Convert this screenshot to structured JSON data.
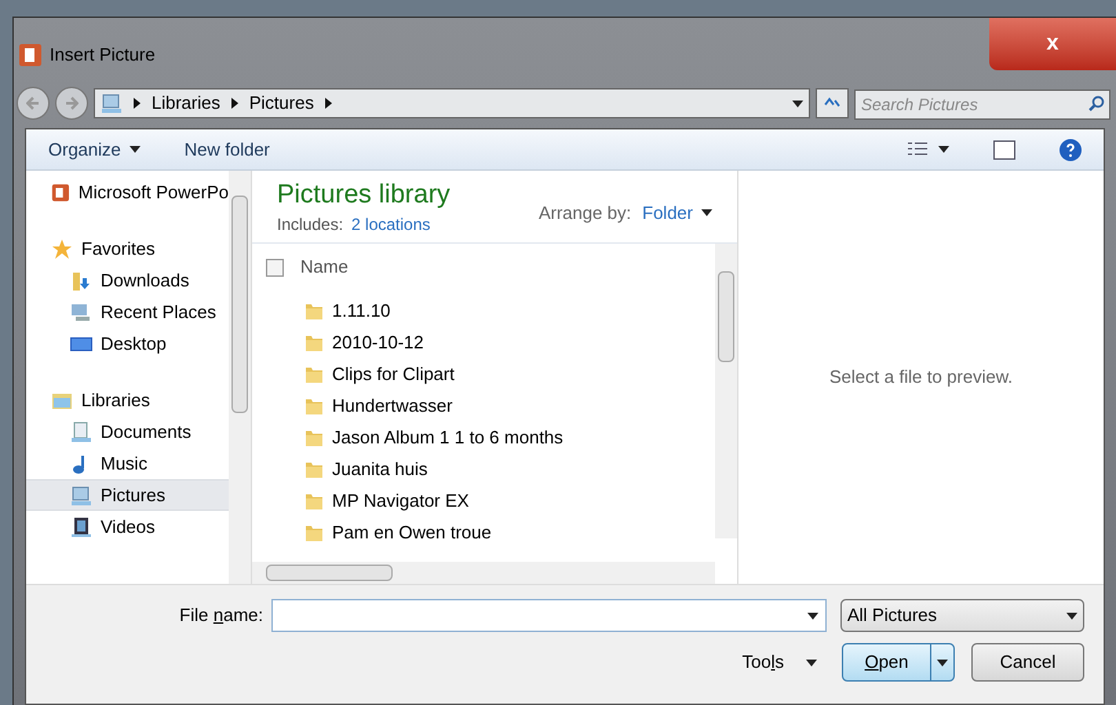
{
  "window": {
    "title": "Insert Picture",
    "close": "x"
  },
  "address": {
    "crumbs": [
      "Libraries",
      "Pictures"
    ],
    "search_placeholder": "Search Pictures"
  },
  "toolbar": {
    "organize": "Organize",
    "new_folder": "New folder"
  },
  "nav": [
    {
      "label": "Microsoft PowerPo",
      "kind": "app",
      "selected": false
    },
    {
      "label": "Favorites",
      "kind": "star",
      "selected": false,
      "children": [
        {
          "label": "Downloads",
          "kind": "download",
          "selected": false
        },
        {
          "label": "Recent Places",
          "kind": "recent",
          "selected": false
        },
        {
          "label": "Desktop",
          "kind": "desktop",
          "selected": false
        }
      ]
    },
    {
      "label": "Libraries",
      "kind": "library",
      "selected": false,
      "children": [
        {
          "label": "Documents",
          "kind": "documents",
          "selected": false
        },
        {
          "label": "Music",
          "kind": "music",
          "selected": false
        },
        {
          "label": "Pictures",
          "kind": "pictures",
          "selected": true
        },
        {
          "label": "Videos",
          "kind": "videos",
          "selected": false
        }
      ]
    }
  ],
  "library": {
    "title": "Pictures library",
    "includes_label": "Includes:",
    "includes_link": "2 locations",
    "arrange_label": "Arrange by:",
    "arrange_value": "Folder"
  },
  "list": {
    "column": "Name",
    "select_all_checked": false,
    "items": [
      "1.11.10",
      "2010-10-12",
      "Clips for Clipart",
      "Hundertwasser",
      "Jason Album 1 1 to 6 months",
      "Juanita huis",
      "MP Navigator EX",
      "Pam en Owen troue"
    ]
  },
  "preview": {
    "message": "Select a file to preview."
  },
  "bottom": {
    "file_name_label": {
      "before": "File ",
      "key": "n",
      "after": "ame:"
    },
    "file_type": "All Pictures",
    "tools": {
      "before": "Too",
      "key": "l",
      "after": "s"
    },
    "open": {
      "key": "O",
      "after": "pen"
    },
    "cancel": "Cancel"
  }
}
